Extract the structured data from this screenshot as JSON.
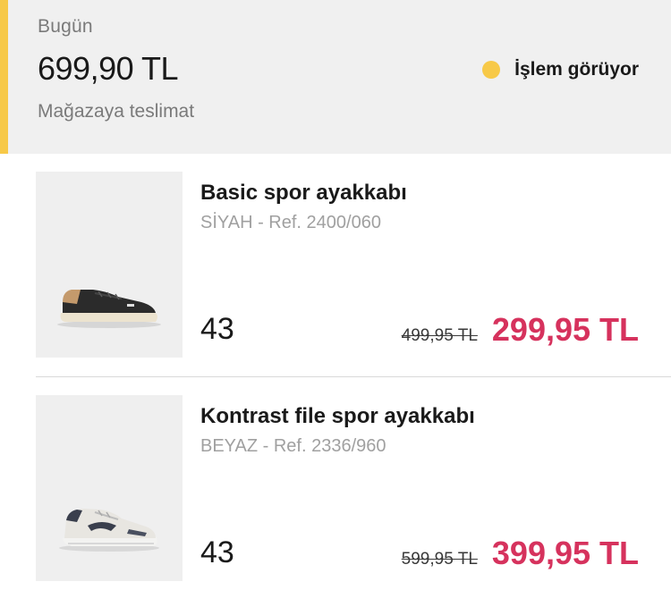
{
  "order": {
    "date_label": "Bugün",
    "total": "699,90 TL",
    "delivery_type": "Mağazaya teslimat",
    "status_text": "İşlem görüyor",
    "status_color": "#f7c948",
    "accent_color": "#f7c948"
  },
  "items": [
    {
      "name": "Basic spor ayakkabı",
      "ref": "SİYAH - Ref. 2400/060",
      "size": "43",
      "old_price": "499,95 TL",
      "new_price": "299,95 TL",
      "image_icon": "black-sneaker-image"
    },
    {
      "name": "Kontrast file spor ayakkabı",
      "ref": "BEYAZ - Ref. 2336/960",
      "size": "43",
      "old_price": "599,95 TL",
      "new_price": "399,95 TL",
      "image_icon": "white-sneaker-image"
    }
  ],
  "colors": {
    "sale_price": "#d6325d"
  }
}
